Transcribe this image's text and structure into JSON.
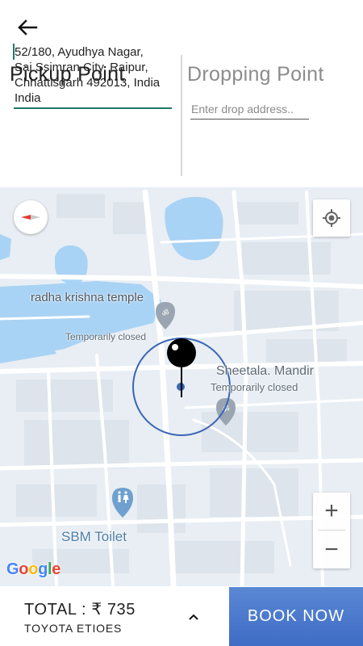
{
  "header": {
    "back_icon": "arrow-left-icon"
  },
  "pickup": {
    "title": "Pickup Point",
    "address": "52/180, Ayudhya Nagar,\nSai Ssimran City, Raipur,\nChhattisgarh 492013, India\nIndia"
  },
  "drop": {
    "title": "Dropping Point",
    "placeholder": "Enter drop address.."
  },
  "map": {
    "labels": {
      "temple": "radha krishna temple",
      "temple_status": "Temporarily closed",
      "mandir": "Sheetala. Mandir",
      "mandir_status": "Temporarily closed",
      "toilet": "SBM Toilet"
    },
    "google_logo": "Google",
    "zoom_in": "+",
    "zoom_out": "−",
    "icons": [
      "compass-icon",
      "my-location-icon",
      "pin-icon",
      "place-marker-icon",
      "toilet-icon"
    ],
    "colors": {
      "water": "#aadaff",
      "land": "#e8eef4",
      "road": "#ffffff",
      "pin": "#000000",
      "radius": "#3a66b5"
    }
  },
  "footer": {
    "total": "TOTAL : ₹ 735",
    "car": "TOYOTA ETIOES",
    "book": "BOOK NOW",
    "accent": "#4a78cc"
  }
}
